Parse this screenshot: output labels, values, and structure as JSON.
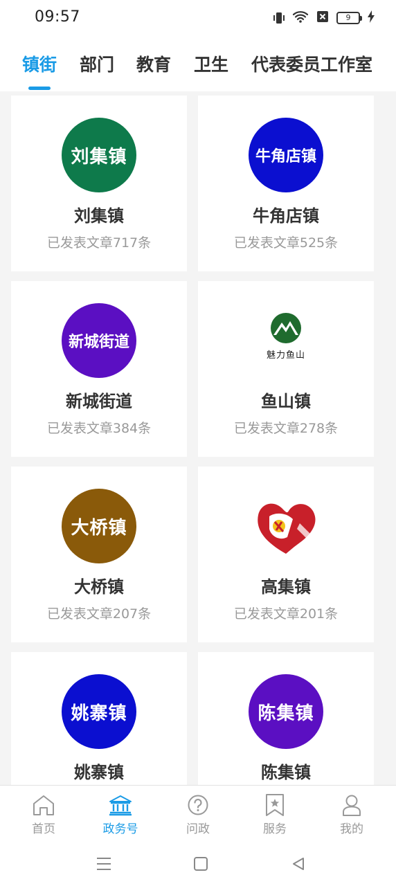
{
  "status": {
    "time": "09:57",
    "battery": "9"
  },
  "tabs": [
    {
      "label": "镇街",
      "active": true
    },
    {
      "label": "部门",
      "active": false
    },
    {
      "label": "教育",
      "active": false
    },
    {
      "label": "卫生",
      "active": false
    },
    {
      "label": "代表委员工作室",
      "active": false
    }
  ],
  "cards": [
    {
      "logo_text": "刘集镇",
      "logo_color": "#0e7a4b",
      "name": "刘集镇",
      "count": "已发表文章717条"
    },
    {
      "logo_text": "牛角店镇",
      "logo_color": "#0b0fd0",
      "name": "牛角店镇",
      "count": "已发表文章525条"
    },
    {
      "logo_text": "新城街道",
      "logo_color": "#5b0fc2",
      "name": "新城街道",
      "count": "已发表文章384条"
    },
    {
      "logo_text": "魅力鱼山",
      "logo_color": "#1f6b2e",
      "name": "鱼山镇",
      "count": "已发表文章278条"
    },
    {
      "logo_text": "大桥镇",
      "logo_color": "#8a5a0a",
      "name": "大桥镇",
      "count": "已发表文章207条"
    },
    {
      "logo_text": "",
      "logo_color": "#c8202a",
      "name": "高集镇",
      "count": "已发表文章201条"
    },
    {
      "logo_text": "姚寨镇",
      "logo_color": "#0b0fd0",
      "name": "姚寨镇",
      "count": ""
    },
    {
      "logo_text": "陈集镇",
      "logo_color": "#5b0fc2",
      "name": "陈集镇",
      "count": ""
    }
  ],
  "bottom_nav": [
    {
      "label": "首页",
      "icon": "home-icon",
      "active": false
    },
    {
      "label": "政务号",
      "icon": "government-building-icon",
      "active": true
    },
    {
      "label": "问政",
      "icon": "question-icon",
      "active": false
    },
    {
      "label": "服务",
      "icon": "bookmark-star-icon",
      "active": false
    },
    {
      "label": "我的",
      "icon": "user-icon",
      "active": false
    }
  ],
  "colors": {
    "accent": "#1a9be6",
    "inactive": "#999999"
  }
}
